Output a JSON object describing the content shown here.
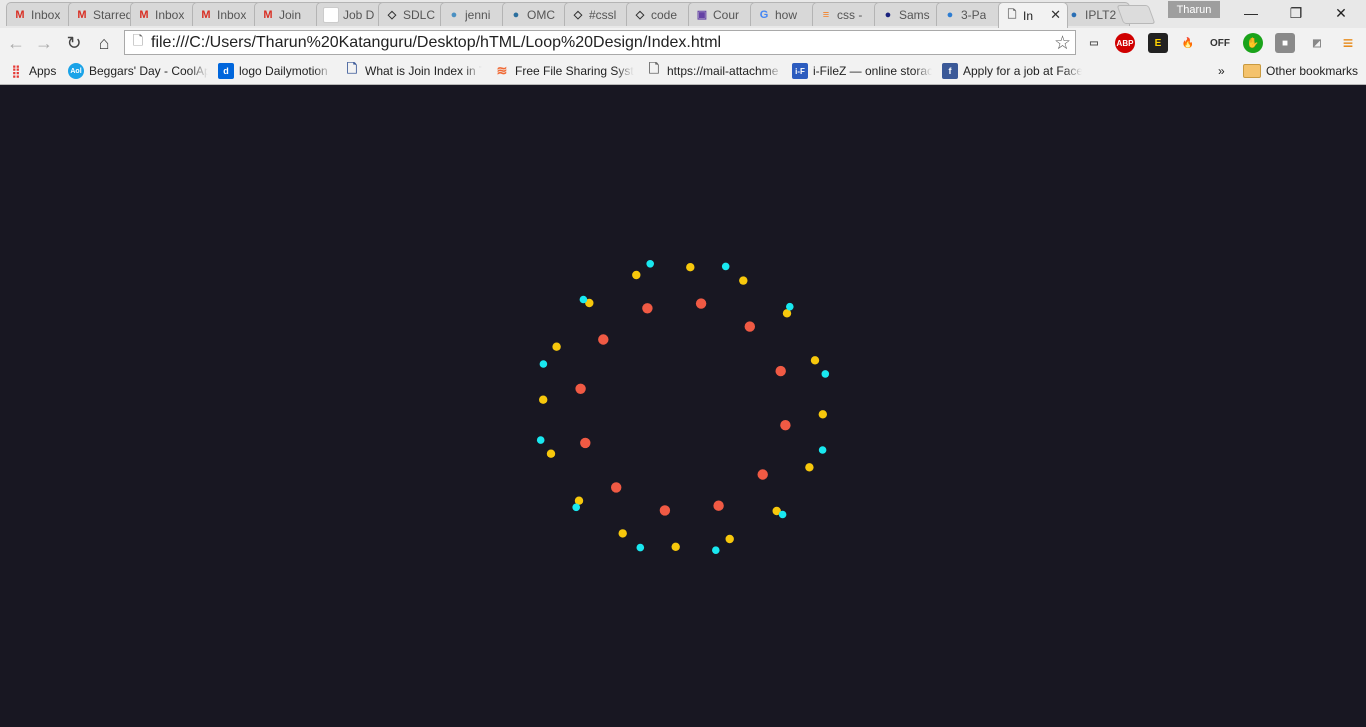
{
  "browser": {
    "tabs": [
      {
        "title": "Inbox",
        "icon": "gmail-icon",
        "icon_color": "#d93025"
      },
      {
        "title": "Starred",
        "icon": "gmail-icon",
        "icon_color": "#d93025"
      },
      {
        "title": "Inbox",
        "icon": "gmail-icon",
        "icon_color": "#d93025"
      },
      {
        "title": "Inbox",
        "icon": "gmail-icon",
        "icon_color": "#d93025"
      },
      {
        "title": "Join",
        "icon": "gmail-icon",
        "icon_color": "#d93025"
      },
      {
        "title": "Job D",
        "icon": "blank-page-icon",
        "icon_color": "#ffffff"
      },
      {
        "title": "SDLC",
        "icon": "codepen-icon",
        "icon_color": "#333333"
      },
      {
        "title": "jenni",
        "icon": "jenkins-icon",
        "icon_color": "#4a90c2"
      },
      {
        "title": "OMC",
        "icon": "wiki-icon",
        "icon_color": "#2b6f9e"
      },
      {
        "title": "#cssl",
        "icon": "codepen-icon",
        "icon_color": "#333333"
      },
      {
        "title": "code",
        "icon": "codepen-icon",
        "icon_color": "#333333"
      },
      {
        "title": "Cour",
        "icon": "twitch-icon",
        "icon_color": "#6441a5"
      },
      {
        "title": "how",
        "icon": "google-icon",
        "icon_color": "#4285f4"
      },
      {
        "title": "css -",
        "icon": "stackoverflow-icon",
        "icon_color": "#f48024"
      },
      {
        "title": "Sams",
        "icon": "sams-icon",
        "icon_color": "#1a237e"
      },
      {
        "title": "3-Pa",
        "icon": "translate-icon",
        "icon_color": "#2d7dd2"
      },
      {
        "title": "In",
        "icon": "page-icon",
        "icon_color": "#666666",
        "active": true
      },
      {
        "title": "IPLT2",
        "icon": "iplt-icon",
        "icon_color": "#2a6fb5"
      }
    ],
    "profile_name": "Tharun",
    "window_buttons": {
      "minimize": "—",
      "restore": "❐",
      "close": "✕"
    },
    "url": "file:///C:/Users/Tharun%20Katanguru/Desktop/hTML/Loop%20Design/Index.html",
    "nav": {
      "back": "←",
      "forward": "→",
      "reload": "↻",
      "home": "⌂",
      "star": "☆"
    },
    "extensions": [
      {
        "name": "cast-icon",
        "label": "▭",
        "bg": "transparent",
        "fg": "#555555"
      },
      {
        "name": "adblock-plus-icon",
        "label": "ABP",
        "bg": "#d00000",
        "fg": "#ffffff"
      },
      {
        "name": "extension-badge-icon",
        "label": "E",
        "bg": "#222222",
        "fg": "#ffd200"
      },
      {
        "name": "fire-icon",
        "label": "🔥",
        "bg": "transparent",
        "fg": "#e65100"
      },
      {
        "name": "off-icon",
        "label": "OFF",
        "bg": "transparent",
        "fg": "#333333"
      },
      {
        "name": "hand-icon",
        "label": "✋",
        "bg": "#1aa31a",
        "fg": "#ffffff"
      },
      {
        "name": "square-icon",
        "label": "■",
        "bg": "#8a8a8a",
        "fg": "#ffffff"
      },
      {
        "name": "slash-icon",
        "label": "◩",
        "bg": "transparent",
        "fg": "#888888"
      },
      {
        "name": "menu-icon",
        "label": "≡",
        "bg": "transparent",
        "fg": "#e67e00"
      }
    ],
    "bookmarks": [
      {
        "label": "Apps",
        "icon": "apps-grid-icon",
        "icon_color": "#e53935"
      },
      {
        "label": "Beggars' Day - CoolAp",
        "icon": "aol-icon",
        "icon_color": "#1aa3e8"
      },
      {
        "label": "logo Dailymotion",
        "icon": "dailymotion-icon",
        "icon_color": "#0066dc"
      },
      {
        "label": "What is Join Index in T",
        "icon": "document-icon",
        "icon_color": "#3b5998"
      },
      {
        "label": "Free File Sharing Syste",
        "icon": "mega-icon",
        "icon_color": "#f06a35"
      },
      {
        "label": "https://mail-attachme",
        "icon": "page-icon",
        "icon_color": "#666666"
      },
      {
        "label": "i-FileZ — online storac",
        "icon": "ifilez-icon",
        "icon_color": "#2c5cbf"
      },
      {
        "label": "Apply for a job at Face",
        "icon": "facebook-icon",
        "icon_color": "#3b5998"
      }
    ],
    "bookmarks_overflow": "»",
    "other_bookmarks": "Other bookmarks"
  },
  "page": {
    "background": "#181722",
    "dot_colors": {
      "red": "#f05a44",
      "yellow": "#f7c80c",
      "cyan": "#19e8f0"
    },
    "rings": [
      {
        "color": "red",
        "count": 12,
        "rotation_deg": 10
      },
      {
        "color": "yellow",
        "count": 16,
        "rotation_deg": 3
      },
      {
        "color": "cyan",
        "count": 12,
        "rotation_deg": 17
      }
    ]
  }
}
